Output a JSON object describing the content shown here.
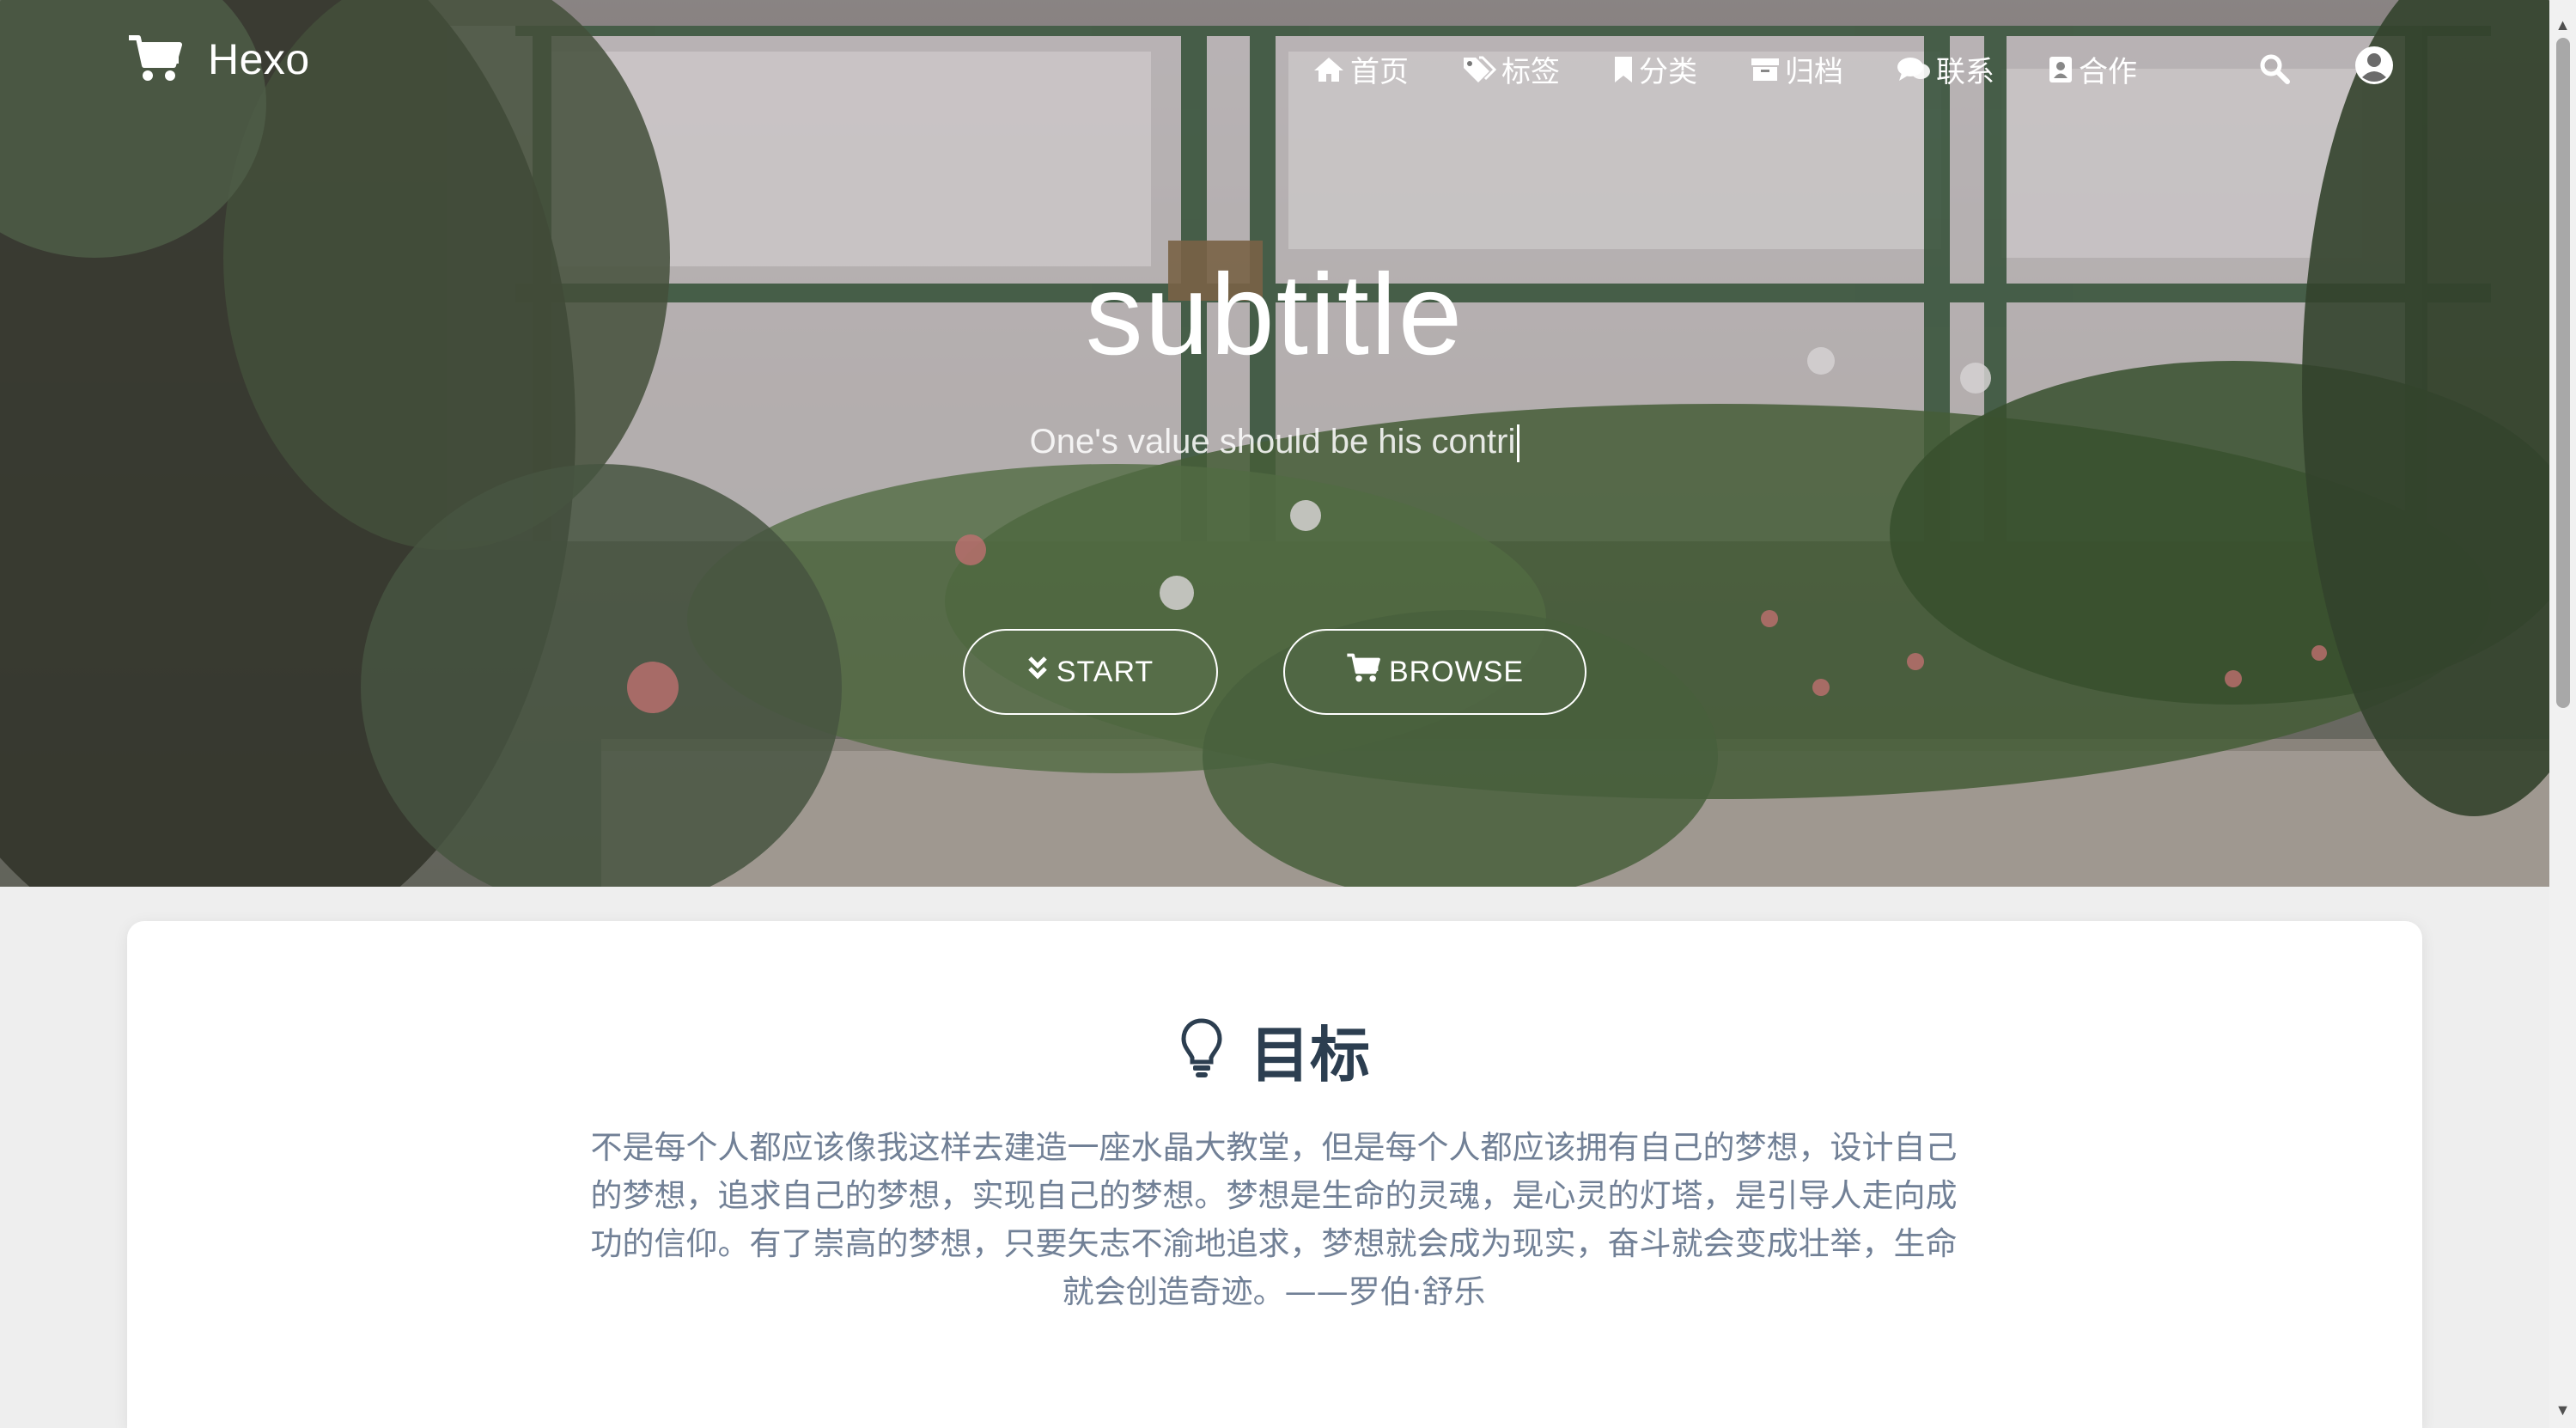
{
  "nav": {
    "brand": "Hexo",
    "items": [
      {
        "label": "首页",
        "icon": "home-icon"
      },
      {
        "label": "标签",
        "icon": "tags-icon"
      },
      {
        "label": "分类",
        "icon": "bookmark-icon"
      },
      {
        "label": "归档",
        "icon": "archive-icon"
      },
      {
        "label": "联系",
        "icon": "comments-icon"
      },
      {
        "label": "合作",
        "icon": "address-book-icon"
      }
    ],
    "search_icon": "search-icon",
    "user_icon": "user-circle-icon"
  },
  "hero": {
    "title": "subtitle",
    "typed_text": "One's value should be his contri",
    "buttons": {
      "start": "START",
      "browse": "BROWSE"
    }
  },
  "card": {
    "title": "目标",
    "icon": "lightbulb-icon",
    "text": "不是每个人都应该像我这样去建造一座水晶大教堂，但是每个人都应该拥有自己的梦想，设计自己的梦想，追求自己的梦想，实现自己的梦想。梦想是生命的灵魂，是心灵的灯塔，是引导人走向成功的信仰。有了崇高的梦想，只要矢志不渝地追求，梦想就会成为现实，奋斗就会变成壮举，生命就会创造奇迹。——罗伯·舒乐"
  },
  "colors": {
    "heading": "#2c3e50",
    "body_text": "#718096",
    "page_bg": "#eeeeee",
    "card_bg": "#ffffff"
  }
}
